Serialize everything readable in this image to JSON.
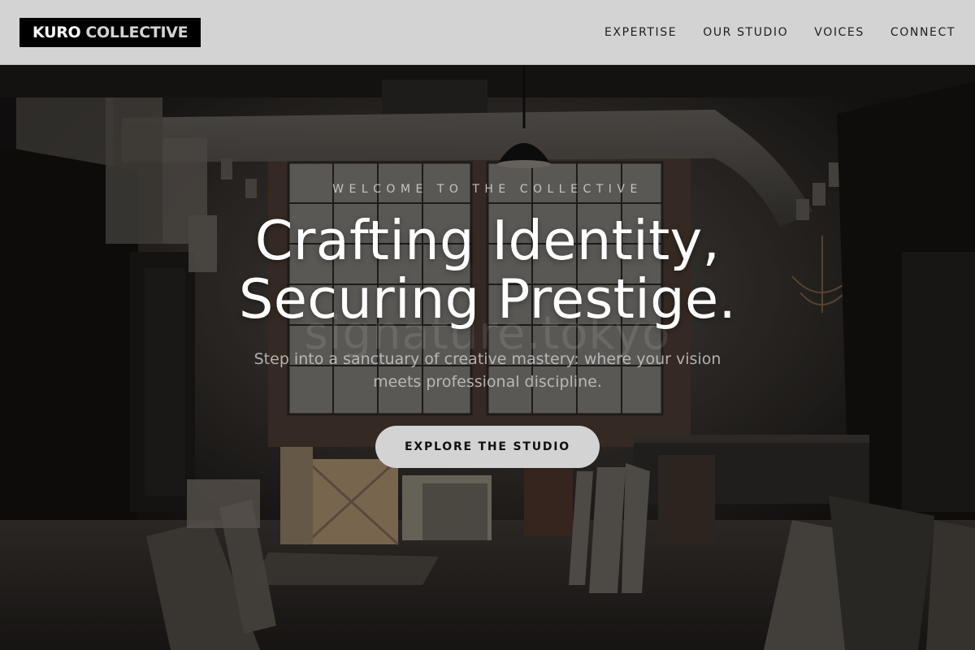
{
  "nav": {
    "logo_primary": "KURO",
    "logo_secondary": "COLLECTIVE",
    "links": [
      {
        "label": "EXPERTISE"
      },
      {
        "label": "OUR STUDIO"
      },
      {
        "label": "VOICES"
      },
      {
        "label": "CONNECT"
      }
    ]
  },
  "hero": {
    "eyebrow": "WELCOME TO THE COLLECTIVE",
    "headline_line1": "Crafting Identity,",
    "headline_line2": "Securing Prestige.",
    "watermark": "signature.tokyo",
    "subtext_line1": "Step into a sanctuary of creative mastery: where your vision",
    "subtext_line2": "meets professional discipline.",
    "cta_label": "EXPLORE THE STUDIO"
  },
  "colors": {
    "nav_background": "#d3d3d3",
    "logo_background": "#000000",
    "cta_background": "#d3d3d3",
    "headline": "#ffffff"
  }
}
